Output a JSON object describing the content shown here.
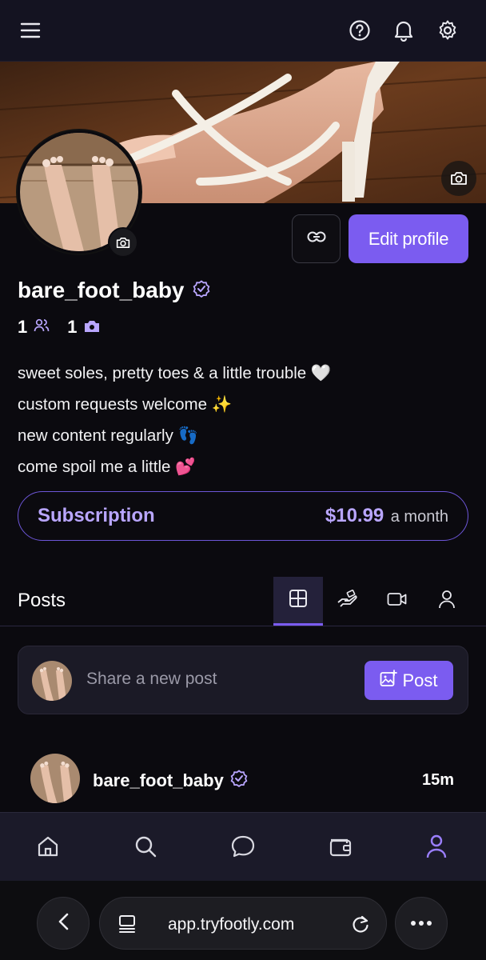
{
  "header": {
    "menu_icon": "hamburger-menu-icon",
    "help_icon": "question-circle-icon",
    "notifications_icon": "bell-icon",
    "settings_icon": "gear-icon"
  },
  "profile": {
    "username": "bare_foot_baby",
    "verified_icon": "verified-badge-icon",
    "followers_count": "1",
    "followers_icon": "people-icon",
    "media_count": "1",
    "media_icon": "camera-icon",
    "copy_link_icon": "link-icon",
    "edit_profile_label": "Edit profile",
    "bio_lines": [
      "sweet soles, pretty toes & a little trouble 🤍",
      "custom requests welcome ✨",
      "new content regularly 👣",
      "come spoil me a little 💕"
    ]
  },
  "subscription": {
    "label": "Subscription",
    "price": "$10.99",
    "period": "a month"
  },
  "posts_section": {
    "title": "Posts",
    "tabs": [
      {
        "icon": "grid-icon",
        "active": true
      },
      {
        "icon": "tip-hand-icon",
        "active": false
      },
      {
        "icon": "video-icon",
        "active": false
      },
      {
        "icon": "person-icon",
        "active": false
      }
    ]
  },
  "composer": {
    "placeholder": "Share a new post",
    "post_label": "Post",
    "post_icon": "image-add-icon"
  },
  "feed": [
    {
      "username": "bare_foot_baby",
      "time": "15m"
    }
  ],
  "bottom_nav": [
    {
      "icon": "home-icon",
      "active": false
    },
    {
      "icon": "search-icon",
      "active": false
    },
    {
      "icon": "chat-bubble-icon",
      "active": false
    },
    {
      "icon": "wallet-icon",
      "active": false
    },
    {
      "icon": "profile-icon",
      "active": true
    }
  ],
  "browser": {
    "url": "app.tryfootly.com",
    "back_icon": "chevron-left-icon",
    "tabs_icon": "tabs-icon",
    "reload_icon": "reload-icon",
    "more_icon": "more-dots-icon"
  },
  "colors": {
    "accent": "#7b5cf0",
    "accent_light": "#b9a6ff",
    "background": "#0b0a0f",
    "nav_bg": "#141321"
  }
}
